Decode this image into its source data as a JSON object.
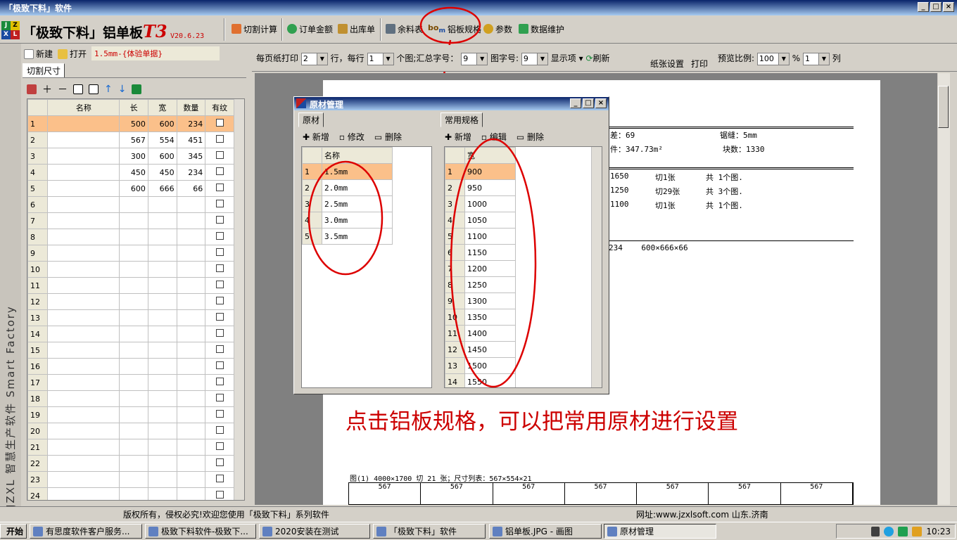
{
  "window": {
    "title": "「极致下料」软件"
  },
  "app": {
    "title_main": "「极致下料」铝单板",
    "title_t3": "T3",
    "version": "V20.6.23"
  },
  "logo": {
    "letters": [
      "J",
      "Z",
      "X",
      "L"
    ]
  },
  "toolbar1": {
    "items": [
      "切割计算",
      "订单金额",
      "出库单",
      "余料表",
      "铝板规格",
      "参数",
      "数据维护"
    ]
  },
  "left": {
    "new": "新建",
    "open": "打开",
    "plan": "1.5mm-{体验单据}",
    "tab": "切割尺寸",
    "columns": [
      "名称",
      "长",
      "宽",
      "数量",
      "有纹"
    ],
    "rows": [
      {
        "n": "1",
        "name": "",
        "l": "500",
        "w": "600",
        "q": "234"
      },
      {
        "n": "2",
        "name": "",
        "l": "567",
        "w": "554",
        "q": "451"
      },
      {
        "n": "3",
        "name": "",
        "l": "300",
        "w": "600",
        "q": "345"
      },
      {
        "n": "4",
        "name": "",
        "l": "450",
        "w": "450",
        "q": "234"
      },
      {
        "n": "5",
        "name": "",
        "l": "600",
        "w": "666",
        "q": "66"
      },
      {
        "n": "6"
      },
      {
        "n": "7"
      },
      {
        "n": "8"
      },
      {
        "n": "9"
      },
      {
        "n": "10"
      },
      {
        "n": "11"
      },
      {
        "n": "12"
      },
      {
        "n": "13"
      },
      {
        "n": "14"
      },
      {
        "n": "15"
      },
      {
        "n": "16"
      },
      {
        "n": "17"
      },
      {
        "n": "18"
      },
      {
        "n": "19"
      },
      {
        "n": "20"
      },
      {
        "n": "21"
      },
      {
        "n": "22"
      },
      {
        "n": "23"
      },
      {
        "n": "24"
      }
    ],
    "side_text": "JZXL 智慧生产软件 Smart Factory"
  },
  "toolbar2": {
    "per_page": "每页纸打印",
    "per_page_val": "2",
    "row_label": "行，每行",
    "per_row_val": "1",
    "pic_label": "个图;汇总字号：",
    "sum_font": "9",
    "pic_font_label": "图字号:",
    "pic_font": "9",
    "display": "显示项",
    "refresh": "刷新",
    "paper": "纸张设置",
    "print": "打印",
    "zoom_label": "预览比例:",
    "zoom": "100",
    "pct": "%",
    "cols_val": "1",
    "cols_label": "列"
  },
  "paper": {
    "line1a": "差：69",
    "line1b": "锯缝：5mm",
    "line2a": "件：347.73m²",
    "line2b": "块数：1330",
    "rows": [
      [
        "1650",
        "切1张",
        "共 1个图."
      ],
      [
        "1250",
        "切29张",
        "共 3个图."
      ],
      [
        "1100",
        "切1张",
        "共 1个图."
      ]
    ],
    "line3": "234    600×666×66",
    "annotation": "点击铝板规格，可以把常用原材进行设置",
    "fig_caption": "图(1) 4000×1700 切 21 张；尺寸列表：567×554×21",
    "strip_vals": [
      "567",
      "567",
      "567",
      "567",
      "567",
      "567",
      "567"
    ]
  },
  "dialog": {
    "title": "原材管理",
    "tab_left": "原材",
    "tab_right": "常用规格",
    "add": "新增",
    "modify": "修改",
    "edit": "编辑",
    "del": "删除",
    "left_header": "名称",
    "left_rows": [
      "1.5mm",
      "2.0mm",
      "2.5mm",
      "3.0mm",
      "3.5mm"
    ],
    "right_header": "宽",
    "right_rows": [
      "900",
      "950",
      "1000",
      "1050",
      "1100",
      "1150",
      "1200",
      "1250",
      "1300",
      "1350",
      "1400",
      "1450",
      "1500",
      "1550"
    ]
  },
  "status": {
    "left": "版权所有，侵权必究!欢迎您使用「极致下料」系列软件",
    "right": "网址:www.jzxlsoft.com 山东.济南"
  },
  "taskbar": {
    "start": "开始",
    "tasks": [
      "有思度软件客户服务...",
      "极致下料软件-极致下...",
      "2020安装在测试",
      "「极致下料」软件",
      "铝单板.JPG - 画图",
      "原材管理"
    ],
    "time": "10:23"
  },
  "colors": {
    "accent": "#0a246a",
    "selected_row": "#fbc08a",
    "annotation": "#c00000"
  }
}
